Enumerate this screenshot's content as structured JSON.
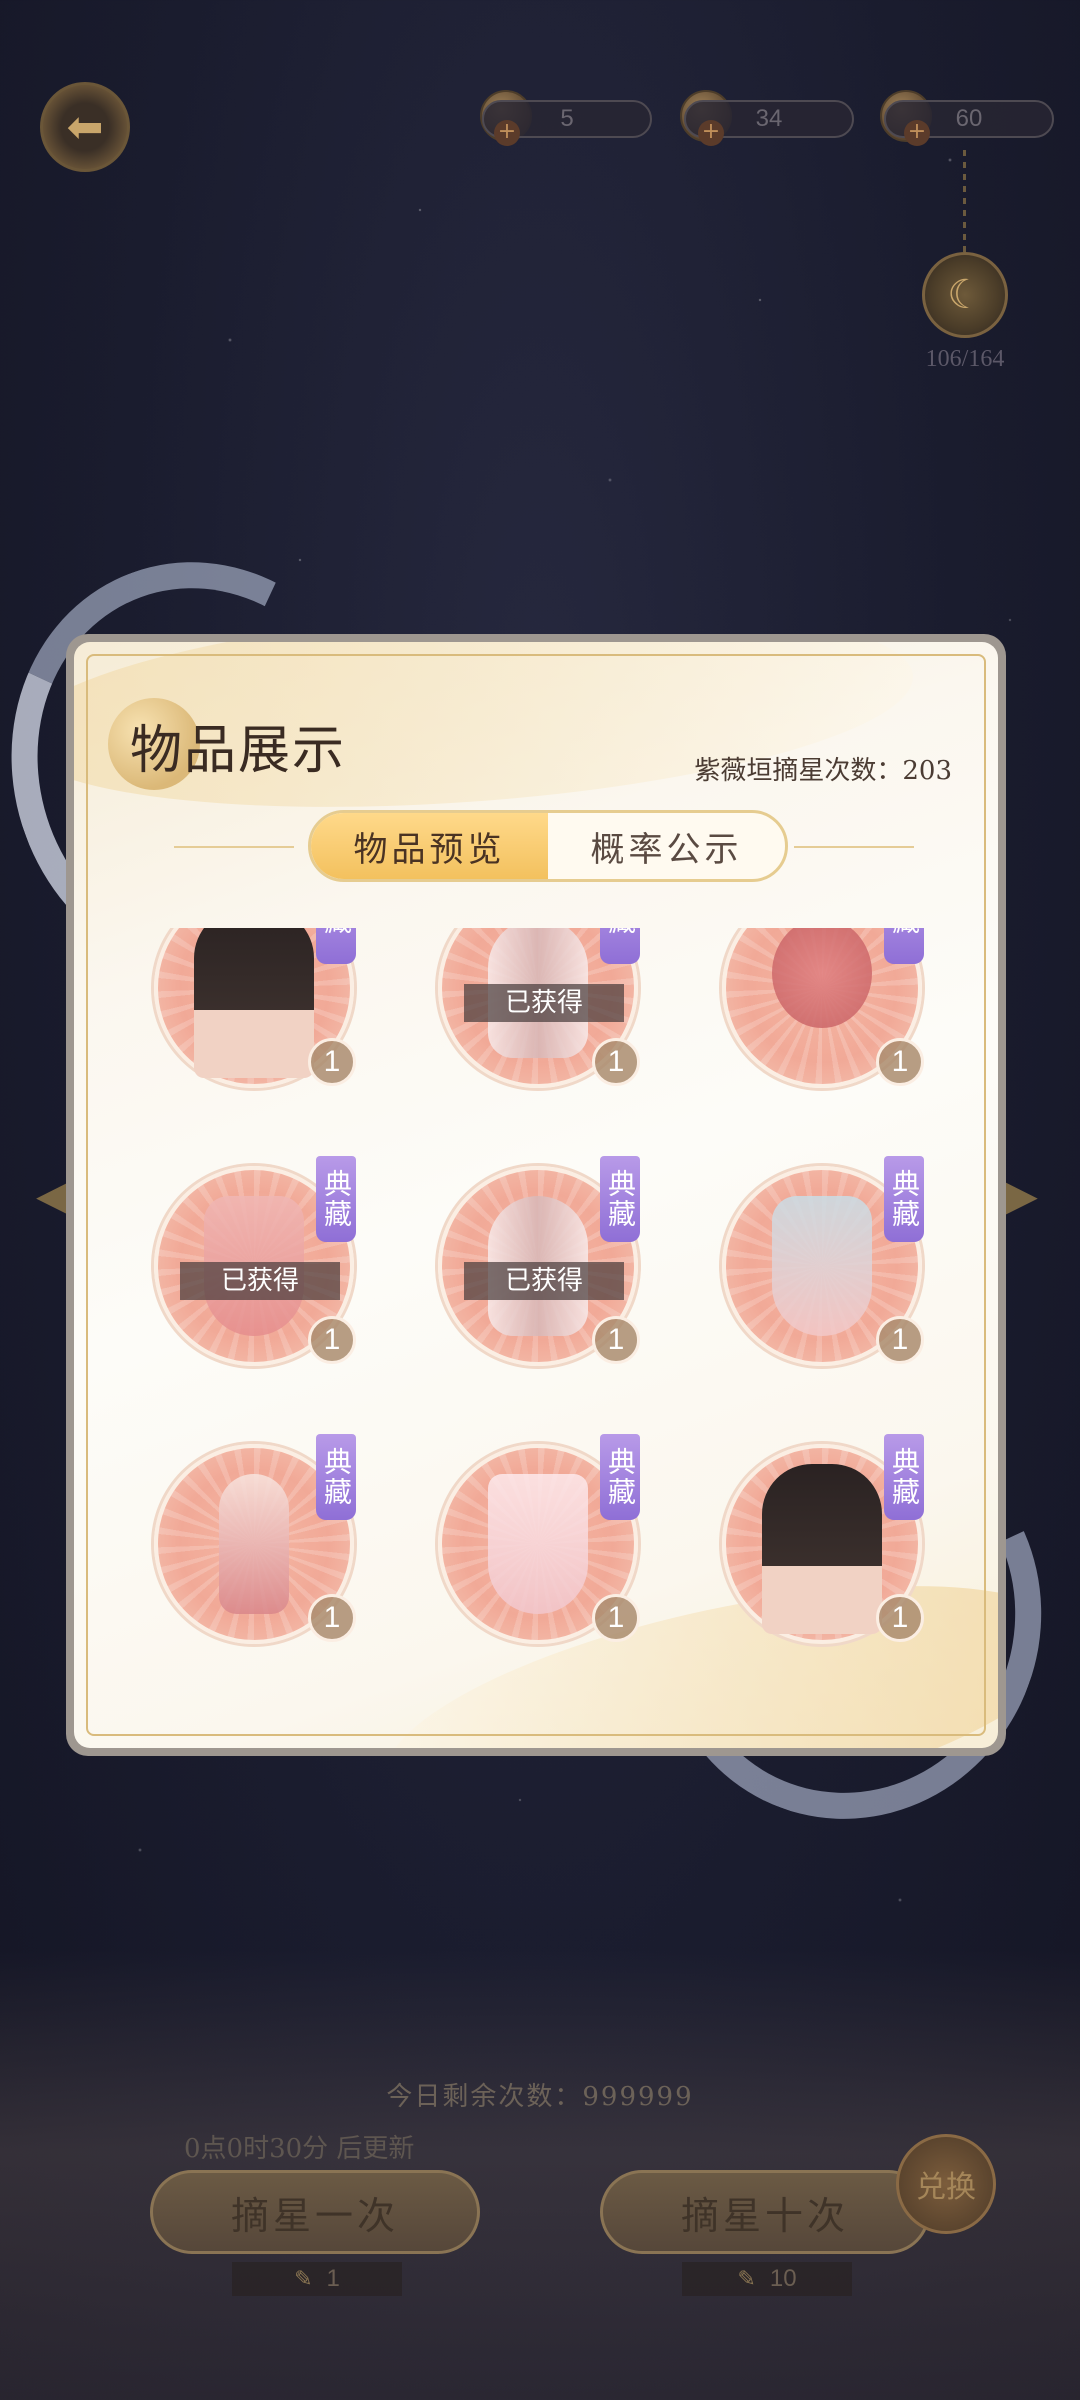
{
  "currencies": [
    {
      "icon": "character-token-icon",
      "value": "5"
    },
    {
      "icon": "gold-coin-icon",
      "value": "34"
    },
    {
      "icon": "pearl-icon",
      "value": "60"
    }
  ],
  "moon_progress": "106/164",
  "panel": {
    "title": "物品展示",
    "draw_count": "紫薇垣摘星次数：203",
    "tabs": [
      {
        "label": "物品预览",
        "active": true
      },
      {
        "label": "概率公示",
        "active": false
      }
    ]
  },
  "items": [
    {
      "kind": "hair",
      "tag": "藏",
      "qty": "1",
      "obtained": ""
    },
    {
      "kind": "wings",
      "tag": "藏",
      "qty": "1",
      "obtained": "已获得"
    },
    {
      "kind": "bag",
      "tag": "藏",
      "qty": "1",
      "obtained": ""
    },
    {
      "kind": "dress",
      "tag": "典藏",
      "qty": "1",
      "obtained": "已获得"
    },
    {
      "kind": "wings",
      "tag": "典藏",
      "qty": "1",
      "obtained": "已获得"
    },
    {
      "kind": "dress",
      "tag": "典藏",
      "qty": "1",
      "obtained": ""
    },
    {
      "kind": "shoes",
      "tag": "典藏",
      "qty": "1",
      "obtained": ""
    },
    {
      "kind": "skirt",
      "tag": "典藏",
      "qty": "1",
      "obtained": ""
    },
    {
      "kind": "hair",
      "tag": "典藏",
      "qty": "1",
      "obtained": ""
    }
  ],
  "bottom": {
    "remaining": "今日剩余次数：999999",
    "refresh": "0点0时30分 后更新",
    "draw_once": "摘星一次",
    "draw_ten": "摘星十次",
    "cost_once": "1",
    "cost_ten": "10",
    "seal_text": "兑换"
  }
}
